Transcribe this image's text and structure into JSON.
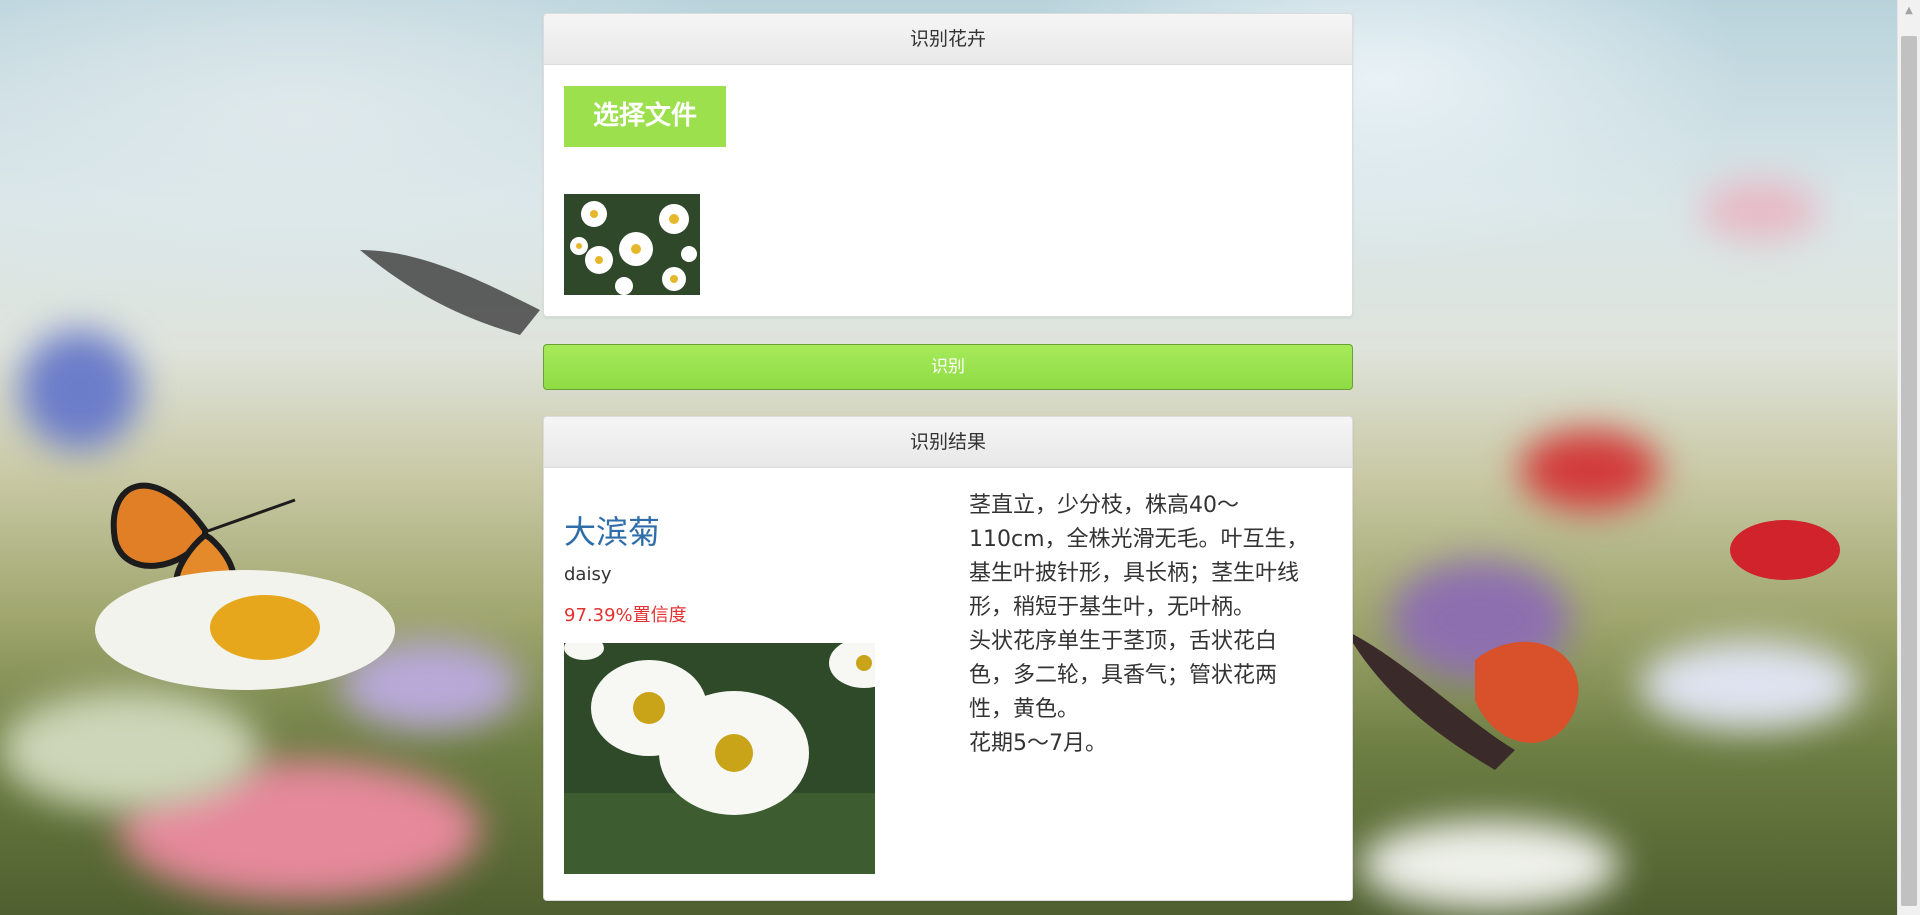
{
  "upload_panel": {
    "title": "识别花卉",
    "choose_file_label": "选择文件"
  },
  "recognize_button_label": "识别",
  "result_panel": {
    "title": "识别结果",
    "flower_name": "大滨菊",
    "flower_latin": "daisy",
    "confidence": "97.39%置信度",
    "description": [
      "茎直立，少分枝，株高40～110cm，全株光滑无毛。叶互生，基生叶披针形，具长柄；茎生叶线形，稍短于基生叶，无叶柄。",
      "头状花序单生于茎顶，舌状花白色，多二轮，具香气；管状花两性，黄色。",
      "花期5～7月。"
    ]
  },
  "colors": {
    "accent_green": "#9ce04e",
    "name_blue": "#2f6ea9",
    "confidence_red": "#e53030"
  }
}
